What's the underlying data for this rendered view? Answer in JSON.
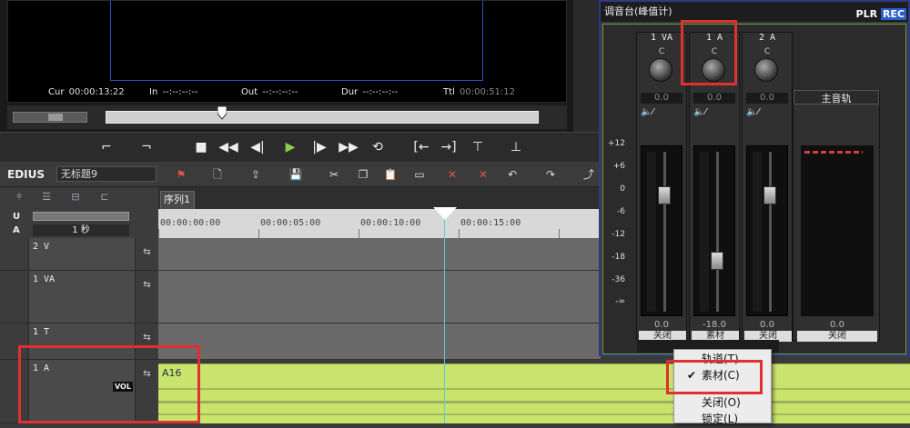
{
  "player": {
    "cur_label": "Cur",
    "cur_value": "00:00:13:22",
    "in_label": "In",
    "in_value": "--:--:--:--",
    "out_label": "Out",
    "out_value": "--:--:--:--",
    "dur_label": "Dur",
    "dur_value": "--:--:--:--",
    "ttl_label": "Ttl",
    "ttl_value": "00:00:51:12"
  },
  "background": {
    "sucai_tab": "素材"
  },
  "toolbar": {
    "app_name": "EDIUS",
    "project_name": "无标题9"
  },
  "timeline": {
    "sequence_tab": "序列1",
    "zoom_label": "1 秒",
    "ruler_labels": [
      "00:00:00:00",
      "00:00:05:00",
      "00:00:10:00",
      "00:00:15:00"
    ],
    "tracks": [
      {
        "name": "2 V"
      },
      {
        "name": "1 VA"
      },
      {
        "name": "1 T"
      },
      {
        "name": "1 A"
      }
    ],
    "vol_badge": "VOL",
    "audio_clip_label": "A16"
  },
  "mixer": {
    "title": "调音台(峰值计)",
    "plr": "PLR",
    "rec": "REC",
    "strips": [
      {
        "name": "1 VA",
        "pan": "0.0",
        "level": "0.0",
        "mode": "关闭"
      },
      {
        "name": "1 A",
        "pan": "0.0",
        "level": "-18.0",
        "mode": "素材"
      },
      {
        "name": "2 A",
        "pan": "0.0",
        "level": "0.0",
        "mode": "关闭"
      }
    ],
    "knob_c": "C",
    "db_scale": [
      "+12",
      "+6",
      "0",
      "-6",
      "-12",
      "-18",
      "-36",
      "-∞"
    ],
    "master": {
      "name": "主音轨",
      "level": "0.0",
      "mode": "关闭"
    }
  },
  "context_menu": {
    "items": [
      {
        "label": "轨道(T)",
        "checked": false
      },
      {
        "label": "素材(C)",
        "checked": true
      },
      {
        "label": "关闭(O)",
        "checked": false
      },
      {
        "label": "锁定(L)",
        "checked": false
      }
    ]
  }
}
